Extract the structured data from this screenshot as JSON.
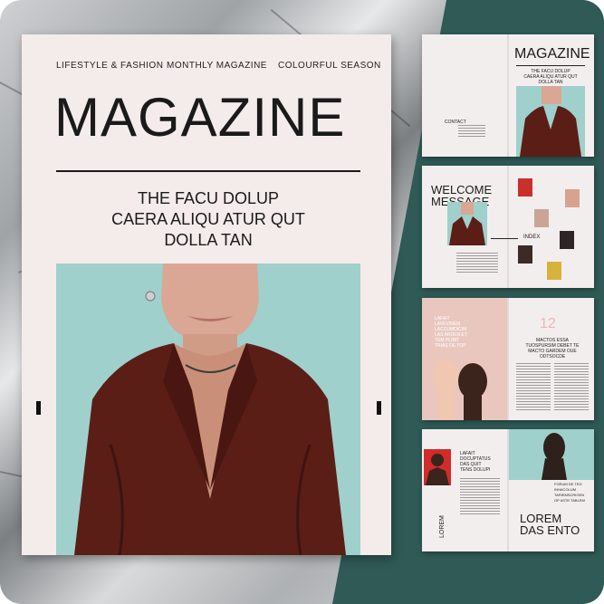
{
  "cover": {
    "meta": [
      "LIFESTYLE & FASHION",
      "MONTHLY MAGAZINE",
      "COLOURFUL SEASON"
    ],
    "title": "MAGAZINE",
    "headline": [
      "THE FACU DOLUP",
      "CAERA ALIQU ATUR QUT",
      "DOLLA TAN"
    ]
  },
  "spread1": {
    "title": "MAGAZINE",
    "headline": [
      "THE FACU DOLUP",
      "CAERA ALIQU ATUR QUT",
      "DOLLA TAN"
    ],
    "contact": "CONTACT"
  },
  "spread2": {
    "title": [
      "WELCOME",
      "MESSAGE"
    ],
    "index": "INDEX"
  },
  "spread3": {
    "pull": [
      "LAFAIT",
      "LAVEVINEM",
      "LACCUMDICIM",
      "LAS ARDEN ET",
      "TEM PLIBIT",
      "TRIAS DE TOP"
    ],
    "number": "12",
    "heading": [
      "MACTOS ESSA",
      "TUOSPURSIM DEBET TE",
      "MACTO GARDEM OUE",
      "ODTSOCDE"
    ]
  },
  "spread4": {
    "quote": [
      "LAFAIT",
      "DOCUPTATUS",
      "DAS QUIT",
      "TENS DOLUPI"
    ],
    "side": "LOREM",
    "title": [
      "LOREM",
      "DAS ENTO"
    ],
    "caption": [
      "FORUM DE TEG",
      "INHACOLUM",
      "TARIEMSCRIGEN",
      "OP ASTE TABLEM"
    ]
  },
  "colors": {
    "teal": "#2f5a56",
    "cover_bg": "#f4ecea",
    "photo_bg": "#9fd0cc",
    "shirt": "#5a1e17",
    "accent": "#d22b2b"
  }
}
